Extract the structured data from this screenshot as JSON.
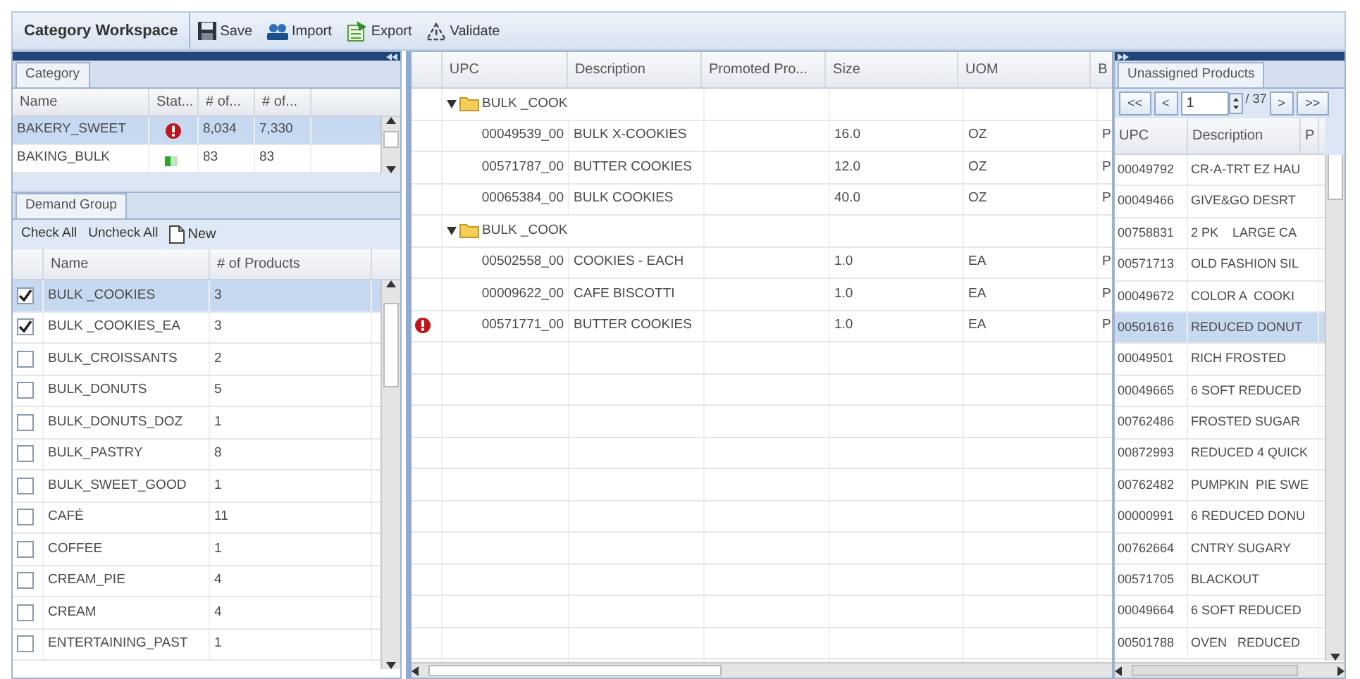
{
  "toolbar": {
    "title": "Category Workspace",
    "buttons": [
      {
        "label": "Save"
      },
      {
        "label": "Import"
      },
      {
        "label": "Export"
      },
      {
        "label": "Validate"
      }
    ]
  },
  "category_panel": {
    "tab": "Category",
    "columns": [
      "Name",
      "Stat...",
      "# of...",
      "# of..."
    ],
    "rows": [
      {
        "name": "BAKERY_SWEET",
        "error": true,
        "count_1": "8,034",
        "count_2": "7,330",
        "selected": true
      },
      {
        "name": "BAKING_BULK",
        "error": false,
        "count_1": "83",
        "count_2": "83",
        "selected": false
      }
    ]
  },
  "demand_group_panel": {
    "tab": "Demand Group",
    "actions": [
      "Check All",
      "Uncheck All"
    ],
    "new_button": "New",
    "columns": [
      "Name",
      "# of Products"
    ],
    "rows": [
      {
        "name": "BULK _COOKIES",
        "products": "3",
        "checked": true,
        "selected": true
      },
      {
        "name": "BULK _COOKIES_EA",
        "products": "3",
        "checked": true,
        "selected": false
      },
      {
        "name": "BULK_CROISSANTS",
        "products": "2",
        "checked": false,
        "selected": false
      },
      {
        "name": "BULK_DONUTS",
        "products": "5",
        "checked": false,
        "selected": false
      },
      {
        "name": "BULK_DONUTS_DOZ",
        "products": "1",
        "checked": false,
        "selected": false
      },
      {
        "name": "BULK_PASTRY",
        "products": "8",
        "checked": false,
        "selected": false
      },
      {
        "name": "BULK_SWEET_GOOD",
        "products": "1",
        "checked": false,
        "selected": false
      },
      {
        "name": "CAFÉ",
        "products": "11",
        "checked": false,
        "selected": false
      },
      {
        "name": "COFFEE",
        "products": "1",
        "checked": false,
        "selected": false
      },
      {
        "name": "CREAM_PIE",
        "products": "4",
        "checked": false,
        "selected": false
      },
      {
        "name": "CREAM",
        "products": "4",
        "checked": false,
        "selected": false
      },
      {
        "name": "ENTERTAINING_PAST",
        "products": "1",
        "checked": false,
        "selected": false
      }
    ]
  },
  "products_grid": {
    "columns": [
      "UPC",
      "Description",
      "Promoted Pro...",
      "Size",
      "UOM",
      "B"
    ],
    "rows": [
      {
        "kind": "group",
        "label": "BULK _COOK",
        "expanded": true
      },
      {
        "kind": "item",
        "upc": "00049539_00",
        "description": "BULK X-COOKIES",
        "size": "16.0",
        "uom": "OZ",
        "column_6": "P",
        "error": false
      },
      {
        "kind": "item",
        "upc": "00571787_00",
        "description": "BUTTER COOKIES",
        "size": "12.0",
        "uom": "OZ",
        "column_6": "P",
        "error": false
      },
      {
        "kind": "item",
        "upc": "00065384_00",
        "description": "BULK COOKIES",
        "size": "40.0",
        "uom": "OZ",
        "column_6": "P",
        "error": false
      },
      {
        "kind": "group",
        "label": "BULK _COOK",
        "expanded": true
      },
      {
        "kind": "item",
        "upc": "00502558_00",
        "description": "COOKIES - EACH",
        "size": "1.0",
        "uom": "EA",
        "column_6": "P",
        "error": false
      },
      {
        "kind": "item",
        "upc": "00009622_00",
        "description": "CAFE BISCOTTI",
        "size": "1.0",
        "uom": "EA",
        "column_6": "P",
        "error": false
      },
      {
        "kind": "item",
        "upc": "00571771_00",
        "description": "BUTTER COOKIES",
        "size": "1.0",
        "uom": "EA",
        "column_6": "P",
        "error": true
      }
    ]
  },
  "unassigned_panel": {
    "tab": "Unassigned Products",
    "pager": {
      "first": "<<",
      "previous": "<",
      "page": "1",
      "total": "/ 37",
      "next": ">",
      "last": ">>"
    },
    "columns": [
      "UPC",
      "Description",
      "P"
    ],
    "rows": [
      {
        "upc": "00049792",
        "description": "CR-A-TRT EZ HAU",
        "selected": false
      },
      {
        "upc": "00049466",
        "description": "GIVE&GO DESRT",
        "selected": false
      },
      {
        "upc": "00758831",
        "description": "2 PK    LARGE CA",
        "selected": false
      },
      {
        "upc": "00571713",
        "description": "OLD FASHION SIL",
        "selected": false
      },
      {
        "upc": "00049672",
        "description": "COLOR A  COOKI",
        "selected": false
      },
      {
        "upc": "00501616",
        "description": "REDUCED DONUT",
        "selected": true
      },
      {
        "upc": "00049501",
        "description": "RICH FROSTED",
        "selected": false
      },
      {
        "upc": "00049665",
        "description": "6 SOFT REDUCED",
        "selected": false
      },
      {
        "upc": "00762486",
        "description": "FROSTED SUGAR",
        "selected": false
      },
      {
        "upc": "00872993",
        "description": "REDUCED 4 QUICK",
        "selected": false
      },
      {
        "upc": "00762482",
        "description": "PUMPKIN  PIE SWE",
        "selected": false
      },
      {
        "upc": "00000991",
        "description": "6 REDUCED DONU",
        "selected": false
      },
      {
        "upc": "00762664",
        "description": "CNTRY SUGARY",
        "selected": false
      },
      {
        "upc": "00571705",
        "description": "BLACKOUT",
        "selected": false
      },
      {
        "upc": "00049664",
        "description": "6 SOFT REDUCED",
        "selected": false
      },
      {
        "upc": "00501788",
        "description": "OVEN   REDUCED",
        "selected": false
      }
    ]
  }
}
